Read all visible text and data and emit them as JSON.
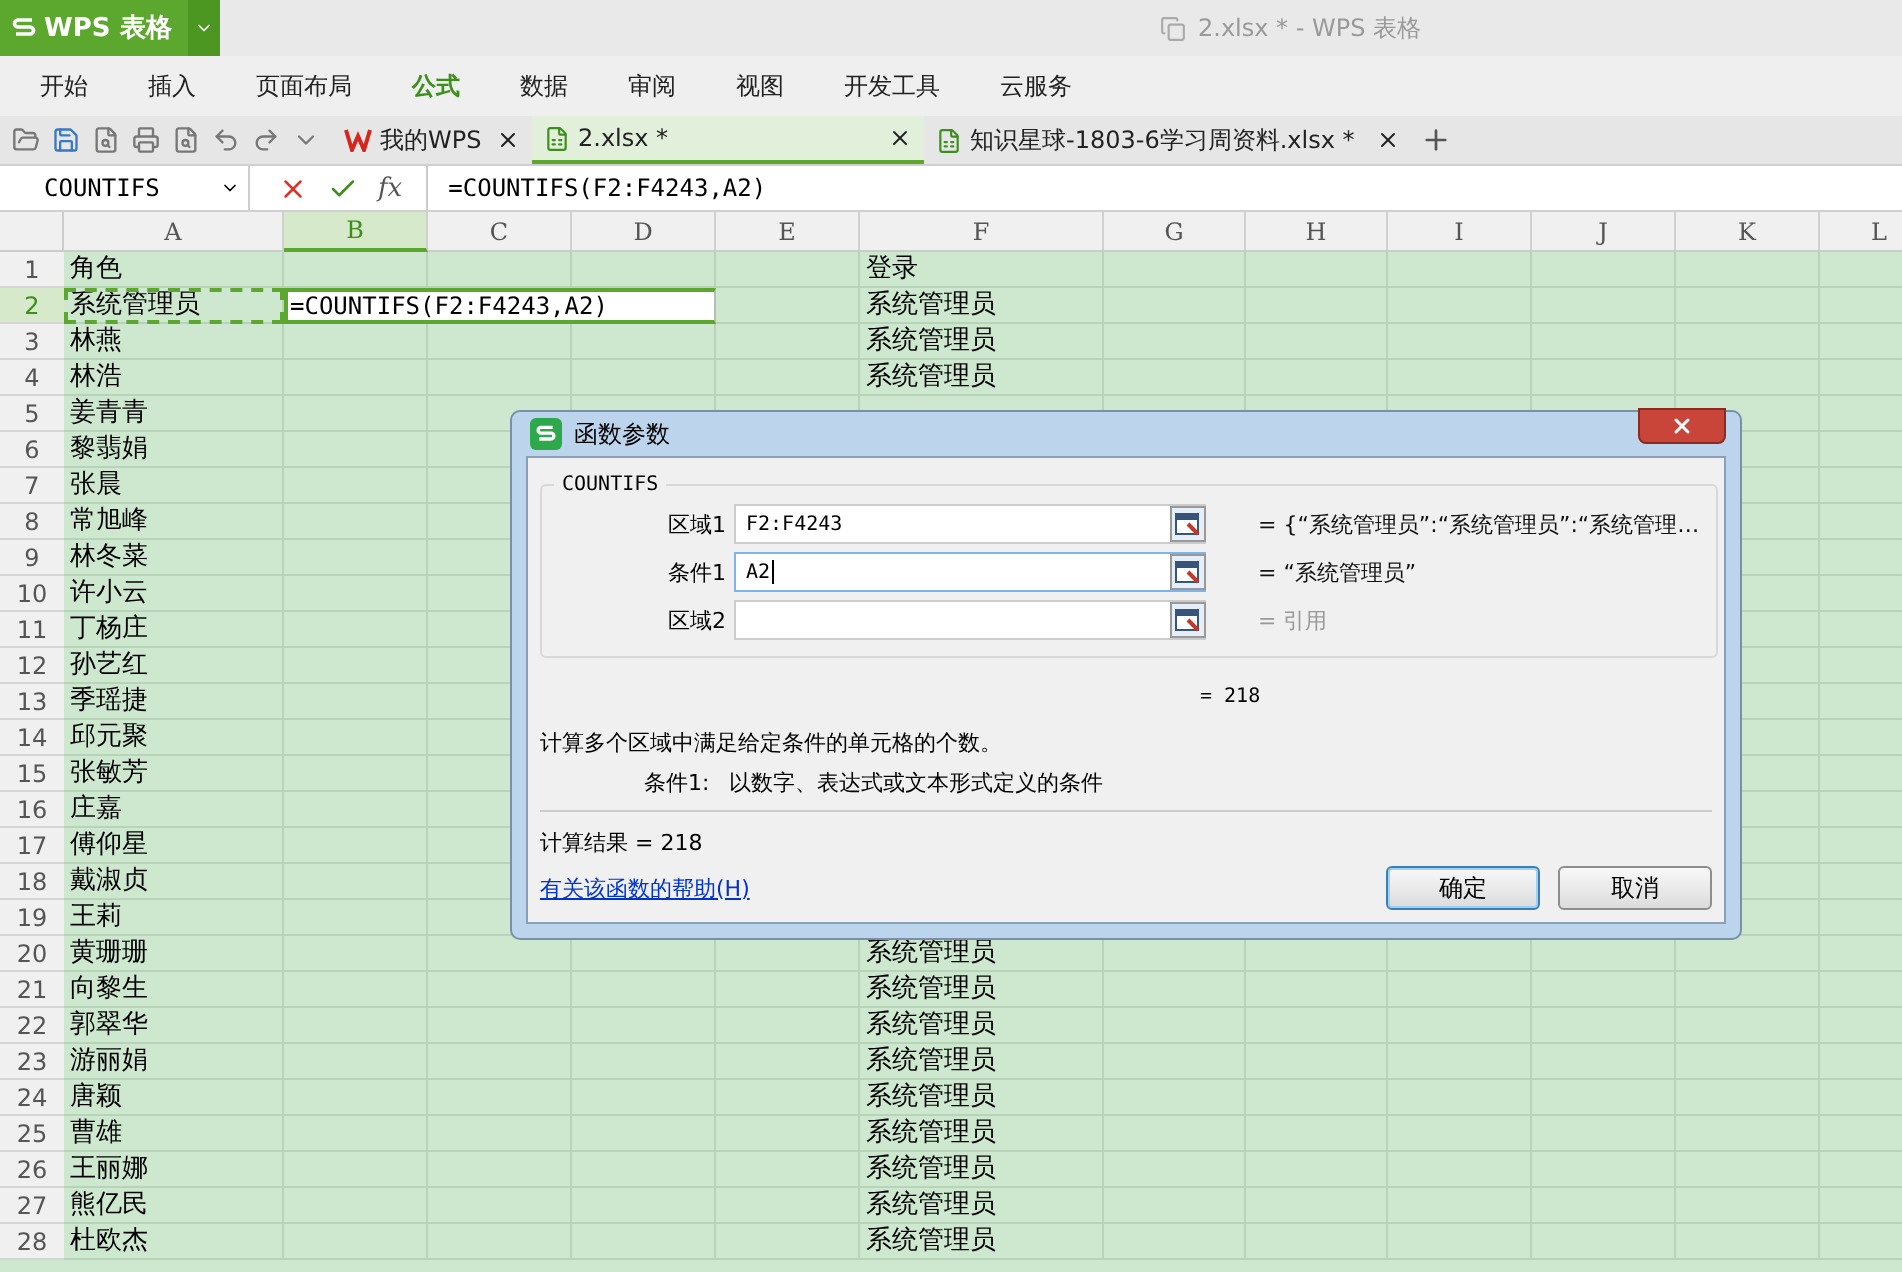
{
  "app_button": {
    "label": "WPS 表格"
  },
  "window": {
    "title": "2.xlsx * - WPS 表格"
  },
  "ribbon_tabs": [
    {
      "label": "开始",
      "selected": false
    },
    {
      "label": "插入",
      "selected": false
    },
    {
      "label": "页面布局",
      "selected": false
    },
    {
      "label": "公式",
      "selected": true
    },
    {
      "label": "数据",
      "selected": false
    },
    {
      "label": "审阅",
      "selected": false
    },
    {
      "label": "视图",
      "selected": false
    },
    {
      "label": "开发工具",
      "selected": false
    },
    {
      "label": "云服务",
      "selected": false
    }
  ],
  "doc_tabs": [
    {
      "label": "我的WPS",
      "kind": "home",
      "selected": false
    },
    {
      "label": "2.xlsx *",
      "kind": "sheet",
      "selected": true
    },
    {
      "label": "知识星球-1803-6学习周资料.xlsx *",
      "kind": "sheet",
      "selected": false
    }
  ],
  "formula_bar": {
    "name_box": "COUNTIFS",
    "fx": "fx",
    "formula": "=COUNTIFS(F2:F4243,A2)"
  },
  "columns": [
    {
      "label": "A",
      "selected": false
    },
    {
      "label": "B",
      "selected": true
    },
    {
      "label": "C",
      "selected": false
    },
    {
      "label": "D",
      "selected": false
    },
    {
      "label": "E",
      "selected": false
    },
    {
      "label": "F",
      "selected": false
    },
    {
      "label": "G",
      "selected": false
    },
    {
      "label": "H",
      "selected": false
    },
    {
      "label": "I",
      "selected": false
    },
    {
      "label": "J",
      "selected": false
    },
    {
      "label": "K",
      "selected": false
    },
    {
      "label": "L",
      "selected": false
    }
  ],
  "rows": [
    {
      "num": "1",
      "a": "角色",
      "f": "登录",
      "selected": false
    },
    {
      "num": "2",
      "a": "系统管理员",
      "f": "系统管理员",
      "selected": true,
      "copy_source": true,
      "editing": "=COUNTIFS(F2:F4243,A2)"
    },
    {
      "num": "3",
      "a": "林燕",
      "f": "系统管理员",
      "selected": false
    },
    {
      "num": "4",
      "a": "林浩",
      "f": "系统管理员",
      "selected": false
    },
    {
      "num": "5",
      "a": "姜青青",
      "selected": false
    },
    {
      "num": "6",
      "a": "黎翡娟",
      "selected": false
    },
    {
      "num": "7",
      "a": "张晨",
      "selected": false
    },
    {
      "num": "8",
      "a": "常旭峰",
      "selected": false
    },
    {
      "num": "9",
      "a": "林冬菜",
      "selected": false
    },
    {
      "num": "10",
      "a": "许小云",
      "selected": false
    },
    {
      "num": "11",
      "a": "丁杨庄",
      "selected": false
    },
    {
      "num": "12",
      "a": "孙艺红",
      "selected": false
    },
    {
      "num": "13",
      "a": "季瑶捷",
      "selected": false
    },
    {
      "num": "14",
      "a": "邱元聚",
      "selected": false
    },
    {
      "num": "15",
      "a": "张敏芳",
      "selected": false
    },
    {
      "num": "16",
      "a": "庄嘉",
      "selected": false
    },
    {
      "num": "17",
      "a": "傅仰星",
      "selected": false
    },
    {
      "num": "18",
      "a": "戴淑贞",
      "selected": false
    },
    {
      "num": "19",
      "a": "王莉",
      "selected": false
    },
    {
      "num": "20",
      "a": "黄珊珊",
      "f": "系统管理员",
      "selected": false
    },
    {
      "num": "21",
      "a": "向黎生",
      "f": "系统管理员",
      "selected": false
    },
    {
      "num": "22",
      "a": "郭翠华",
      "f": "系统管理员",
      "selected": false
    },
    {
      "num": "23",
      "a": "游丽娟",
      "f": "系统管理员",
      "selected": false
    },
    {
      "num": "24",
      "a": "唐颖",
      "f": "系统管理员",
      "selected": false
    },
    {
      "num": "25",
      "a": "曹雄",
      "f": "系统管理员",
      "selected": false
    },
    {
      "num": "26",
      "a": "王丽娜",
      "f": "系统管理员",
      "selected": false
    },
    {
      "num": "27",
      "a": "熊亿民",
      "f": "系统管理员",
      "selected": false
    },
    {
      "num": "28",
      "a": "杜欧杰",
      "f": "系统管理员",
      "selected": false
    }
  ],
  "dialog": {
    "title": "函数参数",
    "function_name": "COUNTIFS",
    "arguments": [
      {
        "label": "区域1",
        "value": "F2:F4243",
        "result": "= {“系统管理员”:“系统管理员”:“系统管理…",
        "muted": false,
        "focused": false
      },
      {
        "label": "条件1",
        "value": "A2",
        "result": "= “系统管理员”",
        "muted": false,
        "focused": true
      },
      {
        "label": "区域2",
        "result": "= 引用",
        "muted": true,
        "focused": false
      }
    ],
    "total": "= 218",
    "description": "计算多个区域中满足给定条件的单元格的个数。",
    "param_name": "条件1:",
    "param_help": "以数字、表达式或文本形式定义的条件",
    "result": "计算结果 = 218",
    "help_link": "有关该函数的帮助(H)",
    "buttons": [
      {
        "label": "确定",
        "default": true
      },
      {
        "label": "取消",
        "default": false
      }
    ]
  }
}
